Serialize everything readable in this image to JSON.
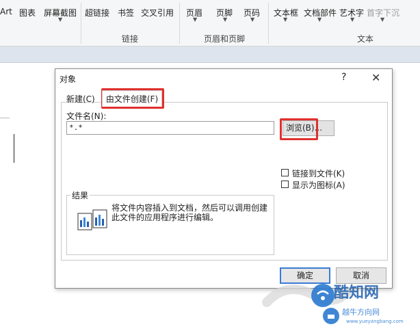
{
  "ribbon": {
    "insert_buttons": [
      {
        "label": "Art"
      },
      {
        "label": "图表"
      },
      {
        "label": "屏幕截图"
      },
      {
        "label": "超链接"
      },
      {
        "label": "书签"
      },
      {
        "label": "交叉引用"
      },
      {
        "label": "页眉"
      },
      {
        "label": "页脚"
      },
      {
        "label": "页码"
      },
      {
        "label": "文本框"
      },
      {
        "label": "文档部件"
      },
      {
        "label": "艺术字"
      },
      {
        "label": "首字下沉"
      }
    ],
    "groups": {
      "links": "链接",
      "header_footer": "页眉和页脚",
      "text": "文本"
    }
  },
  "dialog": {
    "title": "对象",
    "help": "?",
    "close": "✕",
    "tabs": [
      {
        "label": "新建(C)"
      },
      {
        "label": "由文件创建(F)"
      }
    ],
    "filename_label": "文件名(N):",
    "filename_value": "*.*",
    "browse_label": "浏览(B)...",
    "checkboxes": [
      {
        "label": "链接到文件(K)",
        "checked": false
      },
      {
        "label": "显示为图标(A)",
        "checked": false
      }
    ],
    "result_title": "结果",
    "result_text": "将文件内容插入到文档，然后可以调用创建此文件的应用程序进行编辑。",
    "ok_label": "确定",
    "cancel_label": "取消"
  },
  "watermark": {
    "main": "酷知网",
    "sub": "越牛方向网",
    "url": "www.yueyangbang.com"
  },
  "colors": {
    "highlight": "#e0302e",
    "focus_blue": "#3a7bd5"
  }
}
